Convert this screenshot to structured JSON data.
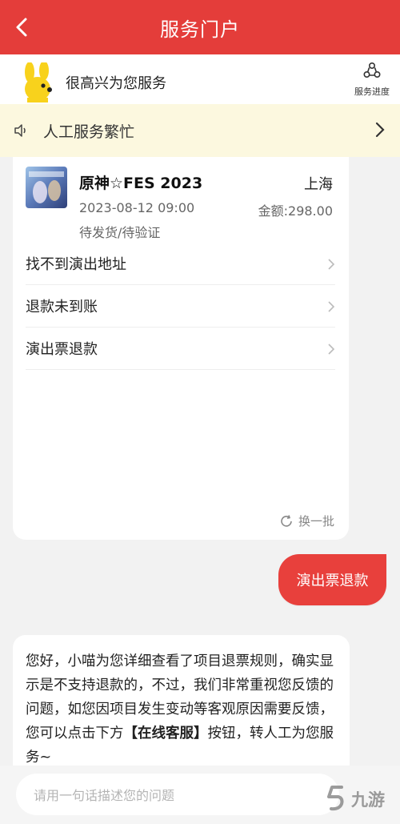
{
  "header": {
    "title": "服务门户"
  },
  "greeting": {
    "text": "很高兴为您服务",
    "progress_label": "服务进度"
  },
  "notice": {
    "text": "人工服务繁忙"
  },
  "order": {
    "name": "原神☆FES 2023",
    "city": "上海",
    "datetime": "2023-08-12 09:00",
    "amount_label": "金额:",
    "amount_value": "298.00",
    "status": "待发货/待验证"
  },
  "options": [
    {
      "label": "找不到演出地址"
    },
    {
      "label": "退款未到账"
    },
    {
      "label": "演出票退款"
    }
  ],
  "refresh_label": "换一批",
  "user_message": "演出票退款",
  "bot_message": {
    "part1": "您好，小喵为您详细查看了项目退票规则，确实显示是不支持退款的，不过，我们非常重视您反馈的问题，如您因项目发生变动等客观原因需要反馈，您可以点击下方",
    "highlight": "【在线客服】",
    "part2": "按钮，转人工为您服务~"
  },
  "input": {
    "placeholder": "请用一句话描述您的问题"
  },
  "watermark": {
    "text": "九游"
  },
  "colors": {
    "brand_red": "#e43d3a",
    "notice_bg": "#fcf8df"
  }
}
